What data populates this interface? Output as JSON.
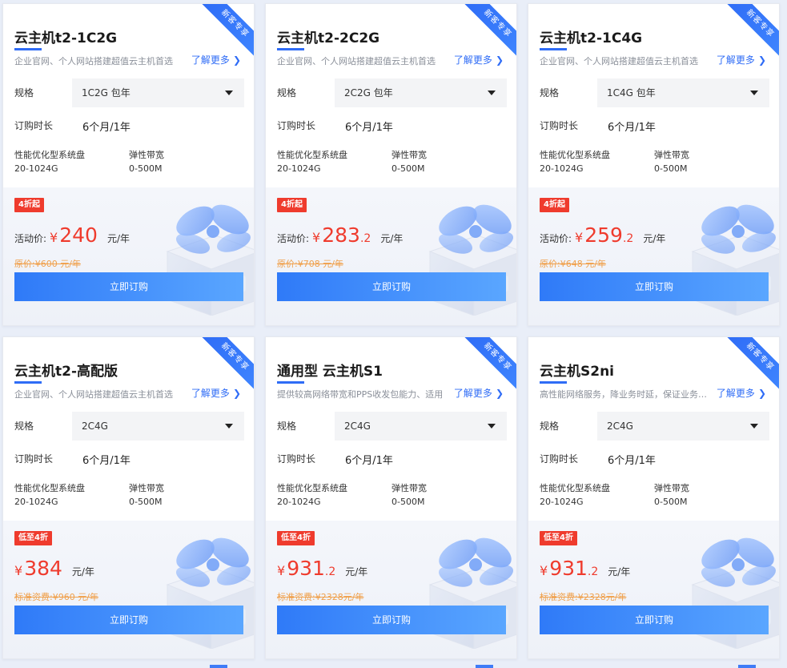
{
  "labels": {
    "ribbon": "新客专享",
    "more": "了解更多",
    "spec": "规格",
    "duration": "订购时长",
    "disk": "性能优化型系统盘",
    "bandwidth": "弹性带宽",
    "buy": "立即订购",
    "unit": "元/年",
    "currency": "¥"
  },
  "cards": [
    {
      "title": "云主机t2-1C2G",
      "desc": "企业官网、个人网站搭建超值云主机首选",
      "spec": "1C2G 包年",
      "duration": "6个月/1年",
      "disk": "20-1024G",
      "bandwidth": "0-500M",
      "badge": "4折起",
      "price_label": "活动价:",
      "price_int": "240",
      "price_dec": "",
      "orig": "原价:¥600 元/年"
    },
    {
      "title": "云主机t2-2C2G",
      "desc": "企业官网、个人网站搭建超值云主机首选",
      "spec": "2C2G 包年",
      "duration": "6个月/1年",
      "disk": "20-1024G",
      "bandwidth": "0-500M",
      "badge": "4折起",
      "price_label": "活动价:",
      "price_int": "283",
      "price_dec": ".2",
      "orig": "原价:¥708 元/年"
    },
    {
      "title": "云主机t2-1C4G",
      "desc": "企业官网、个人网站搭建超值云主机首选",
      "spec": "1C4G 包年",
      "duration": "6个月/1年",
      "disk": "20-1024G",
      "bandwidth": "0-500M",
      "badge": "4折起",
      "price_label": "活动价:",
      "price_int": "259",
      "price_dec": ".2",
      "orig": "原价:¥648 元/年"
    },
    {
      "title": "云主机t2-高配版",
      "desc": "企业官网、个人网站搭建超值云主机首选",
      "spec": "2C4G",
      "duration": "6个月/1年",
      "disk": "20-1024G",
      "bandwidth": "0-500M",
      "badge": "低至4折",
      "price_label": "",
      "price_int": "384",
      "price_dec": "",
      "orig": "标准资费:¥960 元/年"
    },
    {
      "title": "通用型 云主机S1",
      "desc": "提供较高网络带宽和PPS收发包能力、适用",
      "spec": "2C4G",
      "duration": "6个月/1年",
      "disk": "20-1024G",
      "bandwidth": "0-500M",
      "badge": "低至4折",
      "price_label": "",
      "price_int": "931",
      "price_dec": ".2",
      "orig": "标准资费:¥2328元/年"
    },
    {
      "title": "云主机S2ni",
      "desc": "高性能网络服务，降业务时延，保证业务稳定",
      "spec": "2C4G",
      "duration": "6个月/1年",
      "disk": "20-1024G",
      "bandwidth": "0-500M",
      "badge": "低至4折",
      "price_label": "",
      "price_int": "931",
      "price_dec": ".2",
      "orig": "标准资费:¥2328元/年"
    }
  ],
  "colors": {
    "accent": "#2f6cf6",
    "price": "#ef3b2d",
    "original_price": "#f0a04b"
  }
}
